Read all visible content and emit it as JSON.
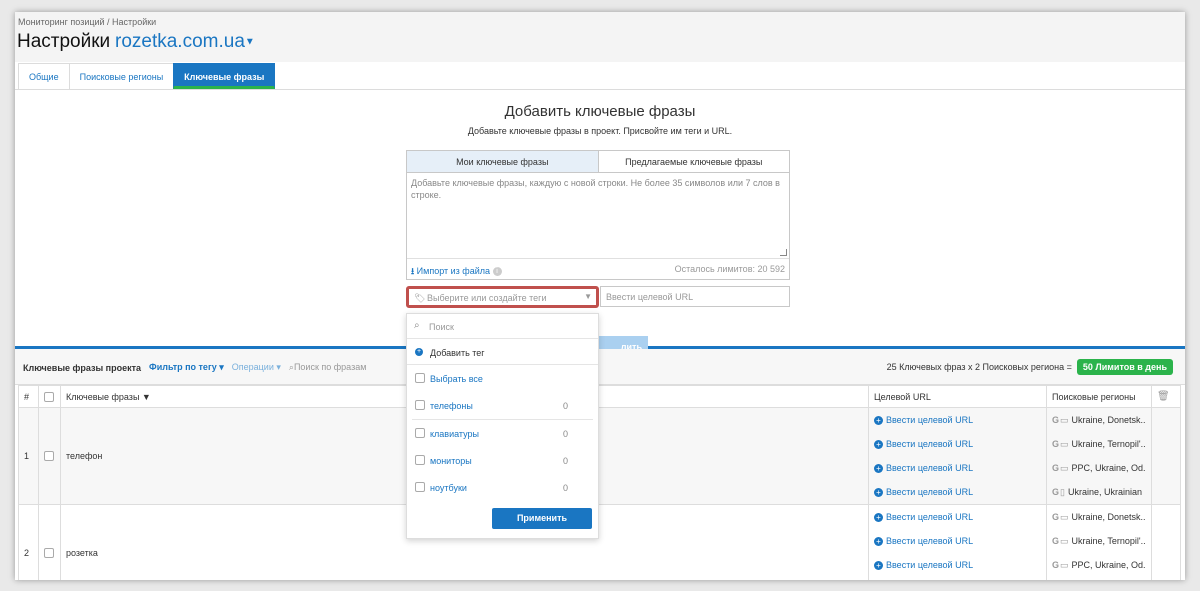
{
  "breadcrumb": "Мониторинг позиций / Настройки",
  "page": {
    "title": "Настройки",
    "domain": "rozetka.com.ua"
  },
  "tabs": [
    "Общие",
    "Поисковые регионы",
    "Ключевые фразы"
  ],
  "add_section": {
    "heading": "Добавить ключевые фразы",
    "subtitle": "Добавьте ключевые фразы в проект. Присвойте им теги и URL.",
    "tab_mine": "Мои ключевые фразы",
    "tab_suggested": "Предлагаемые ключевые фразы",
    "textarea_placeholder": "Добавьте ключевые фразы, каждую с новой строки. Не более 35 символов или 7 слов в строке.",
    "import_label": "Импорт из файла",
    "limits_left": "Осталось лимитов: 20 592",
    "tag_placeholder": "Выберите или создайте теги",
    "url_placeholder": "Ввести целевой URL",
    "add_button": "лить"
  },
  "tag_dropdown": {
    "search_placeholder": "Поиск",
    "add_tag": "Добавить тег",
    "select_all": "Выбрать все",
    "tags": [
      {
        "name": "телефоны",
        "count": "0"
      },
      {
        "name": "клавиатуры",
        "count": "0"
      },
      {
        "name": "мониторы",
        "count": "0"
      },
      {
        "name": "ноутбуки",
        "count": "0"
      }
    ],
    "apply": "Применить"
  },
  "toolbar": {
    "label": "Ключевые фразы проекта",
    "filter": "Фильтр по тегу",
    "operations": "Операции",
    "search": "Поиск по фразам",
    "summary": "25 Ключевых фраз x 2 Поисковых региона =",
    "limits_badge": "50 Лимитов в день"
  },
  "table": {
    "headers": {
      "num": "#",
      "keywords": "Ключевые фразы",
      "url": "Целевой URL",
      "regions": "Поисковые регионы"
    },
    "url_action": "Ввести целевой URL",
    "rows": [
      {
        "num": "1",
        "keyword": "телефон",
        "regions": [
          "Ukraine, Donetsk...",
          "Ukraine, Ternopil'...",
          "PPC, Ukraine, Od...",
          "Ukraine, Ukrainian"
        ]
      },
      {
        "num": "2",
        "keyword": "розетка",
        "regions": [
          "Ukraine, Donetsk...",
          "Ukraine, Ternopil'...",
          "PPC, Ukraine, Od..."
        ]
      }
    ]
  }
}
